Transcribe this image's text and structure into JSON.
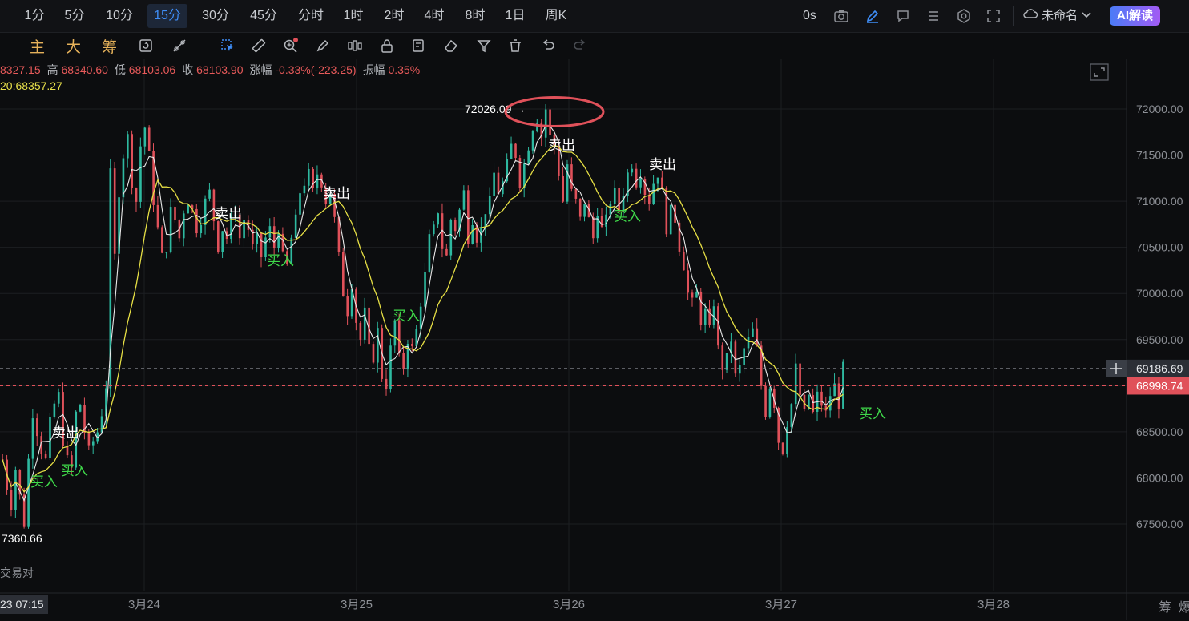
{
  "toolbar": {
    "timeframes": [
      "1分",
      "5分",
      "10分",
      "15分",
      "30分",
      "45分",
      "分时",
      "1时",
      "2时",
      "4时",
      "8时",
      "1日",
      "周K"
    ],
    "active_timeframe": "15分",
    "timer": "0s",
    "layout_name": "未命名",
    "ai_button": "AI解读",
    "icons": [
      "camera-icon",
      "pencil-icon",
      "comment-icon",
      "list-icon",
      "settings-icon",
      "fullscreen-icon",
      "chevron-down-icon"
    ]
  },
  "indicators": {
    "main": "主",
    "big": "大",
    "chip": "筹"
  },
  "drawing_tools": [
    "cursor-icon",
    "ruler-icon",
    "zoom-in-icon",
    "brush-icon",
    "bar-chart-icon",
    "lock-icon",
    "edit-list-icon",
    "eraser-icon",
    "filter-icon",
    "trash-icon",
    "undo-icon",
    "redo-icon"
  ],
  "ohlc": {
    "open_partial": "8327.15",
    "high_label": "高",
    "high": "68340.60",
    "low_label": "低",
    "low": "68103.06",
    "close_label": "收",
    "close": "68103.90",
    "change_label": "涨幅",
    "change": "-0.33%(-223.25)",
    "amp_label": "振幅",
    "amp": "0.35%"
  },
  "ma_text": "20:68357.27",
  "pair_label": "交易对",
  "crosshair_time": "23 07:15",
  "corner_labels": [
    "筹",
    "爆"
  ],
  "colors": {
    "up": "#2eb9a0",
    "down": "#e0515a",
    "ma_fast": "#e8e8e8",
    "ma_slow": "#e6df45",
    "accent": "#3f8ef7",
    "buy": "#3fd94a",
    "sell": "#ffffff"
  },
  "chart_data": {
    "type": "candlestick",
    "y_ticks": [
      67500,
      68000,
      68500,
      69000,
      69500,
      70000,
      70500,
      71000,
      71500,
      72000
    ],
    "y_tick_labels": [
      "67500.00",
      "68000.00",
      "68500.00",
      "69000.00",
      "69500.00",
      "70000.00",
      "70500.00",
      "71000.00",
      "71500.00",
      "72000.00"
    ],
    "ylim": [
      67150,
      72550
    ],
    "x_labels": [
      "3月24",
      "3月25",
      "3月26",
      "3月27",
      "3月28"
    ],
    "current_price": "69186.69",
    "current_value": 69186.69,
    "last_close_price": "68998.74",
    "last_close_value": 68998.74,
    "high_marker": {
      "label": "72026.09",
      "value": 72026.09
    },
    "low_marker": {
      "label": "7360.66",
      "value": 67360.66
    },
    "signals": [
      {
        "text": "买入",
        "type": "buy",
        "value": 67960
      },
      {
        "text": "卖出",
        "type": "sell",
        "value": 68490
      },
      {
        "text": "买入",
        "type": "buy",
        "value": 68080
      },
      {
        "text": "卖出",
        "type": "sell",
        "value": 70870
      },
      {
        "text": "买入",
        "type": "buy",
        "value": 70360
      },
      {
        "text": "卖出",
        "type": "sell",
        "value": 71090
      },
      {
        "text": "买入",
        "type": "buy",
        "value": 69760
      },
      {
        "text": "卖出",
        "type": "sell",
        "value": 71610
      },
      {
        "text": "买入",
        "type": "buy",
        "value": 70840
      },
      {
        "text": "卖出",
        "type": "sell",
        "value": 71400
      },
      {
        "text": "买入",
        "type": "buy",
        "value": 68700
      }
    ],
    "price_path": [
      68200,
      67900,
      67700,
      68100,
      67800,
      67500,
      68200,
      68700,
      68500,
      68300,
      68200,
      68600,
      68800,
      68900,
      68400,
      68200,
      68100,
      68700,
      68800,
      68500,
      68300,
      68400,
      68500,
      68700,
      69000,
      71300,
      70400,
      71100,
      71500,
      71700,
      71200,
      71000,
      71600,
      71800,
      71500,
      71000,
      70700,
      70400,
      70500,
      70900,
      70800,
      70600,
      70900,
      71000,
      70900,
      70700,
      70800,
      71000,
      71100,
      70800,
      70500,
      70700,
      70600,
      70800,
      70900,
      70600,
      70800,
      70700,
      70500,
      70600,
      70400,
      70600,
      70700,
      70500,
      70700,
      70400,
      70300,
      70600,
      70800,
      71100,
      71200,
      71300,
      71100,
      71300,
      71200,
      71000,
      71100,
      70800,
      70400,
      70000,
      69800,
      70100,
      69700,
      69500,
      69800,
      69400,
      69300,
      69600,
      69100,
      69000,
      69400,
      69700,
      69300,
      69200,
      69500,
      69400,
      69600,
      69900,
      70200,
      70600,
      70700,
      70900,
      70500,
      70400,
      70800,
      70700,
      70900,
      71100,
      70600,
      70800,
      70600,
      70700,
      70900,
      71000,
      71300,
      71100,
      71200,
      71400,
      71600,
      71500,
      71200,
      71400,
      71600,
      71800,
      71900,
      71700,
      72000,
      71700,
      71600,
      71300,
      71000,
      71400,
      71100,
      71000,
      70800,
      71000,
      70800,
      70600,
      70900,
      70700,
      70800,
      71000,
      71100,
      70900,
      71100,
      71300,
      71400,
      71200,
      71300,
      71100,
      71000,
      71200,
      71300,
      71100,
      70700,
      70900,
      70800,
      70500,
      70300,
      70000,
      69900,
      70000,
      69700,
      69800,
      69600,
      69900,
      69400,
      69200,
      69300,
      69500,
      69100,
      69200,
      69400,
      69500,
      69600,
      69400,
      69000,
      68700,
      69000,
      68800,
      68400,
      68300,
      68600,
      68800,
      69200,
      68900,
      68700,
      68900,
      68700,
      68900,
      68800,
      68700,
      68900,
      69000,
      68800,
      69200
    ]
  }
}
